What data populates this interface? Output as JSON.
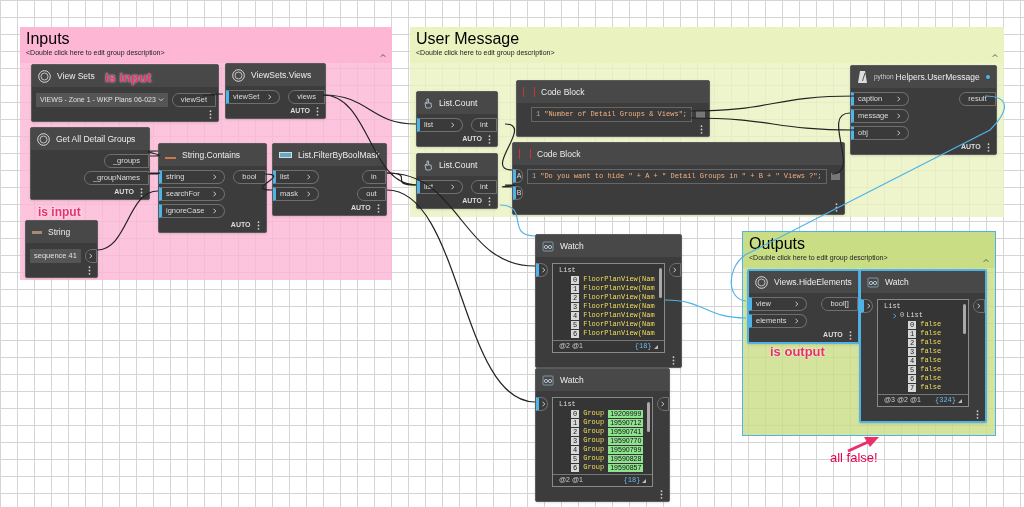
{
  "groups": [
    {
      "title": "Inputs",
      "description": "<Double click here to edit group description>",
      "color": "#fdb7d5",
      "selected": false
    },
    {
      "title": "User Message",
      "description": "<Double click here to edit group description>",
      "color": "#eaf2c0",
      "selected": false
    },
    {
      "title": "Outputs",
      "description": "<Double click here to edit group description>",
      "color": "#c9dd85",
      "selected": true
    }
  ],
  "nodes": [
    {
      "kind": "dropdown",
      "title": "View Sets",
      "value": "VIEWS - Zone 1 - WKP Plans 06-023",
      "outputs": [
        "viewSet"
      ],
      "selected": false
    },
    {
      "kind": "node",
      "title": "ViewSets.Views",
      "inputs": [
        "viewSet"
      ],
      "outputs": [
        "views"
      ],
      "footer": "AUTO",
      "selected": false
    },
    {
      "kind": "node",
      "title": "Get All Detail Groups",
      "outputs": [
        "_groups",
        "_groupNames"
      ],
      "footer": "AUTO",
      "selected": false
    },
    {
      "kind": "node",
      "title": "String.Contains",
      "inputs": [
        "string",
        "searchFor",
        "ignoreCase"
      ],
      "outputs": [
        "bool"
      ],
      "footer": "AUTO",
      "selected": false
    },
    {
      "kind": "node",
      "title": "List.FilterByBoolMask",
      "inputs": [
        "list",
        "mask"
      ],
      "outputs": [
        "in",
        "out"
      ],
      "footer": "AUTO",
      "selected": false
    },
    {
      "kind": "string_input",
      "title": "String",
      "value": "sequence 41",
      "selected": false
    },
    {
      "kind": "node",
      "title": "List.Count",
      "inputs": [
        "list"
      ],
      "outputs": [
        "int"
      ],
      "footer": "AUTO",
      "selected": false
    },
    {
      "kind": "node",
      "title": "List.Count",
      "inputs": [
        "list"
      ],
      "outputs": [
        "int"
      ],
      "footer": "AUTO",
      "selected": false
    },
    {
      "kind": "code",
      "title": "Code Block",
      "line_number": "1",
      "code": "\"Number of Detail Groups & Views\";",
      "selected": false
    },
    {
      "kind": "code",
      "title": "Code Block",
      "inputs": [
        "A",
        "B"
      ],
      "line_number": "1",
      "code": "\"Do you want to hide \" + A + \" Detail Groups in \" + B + \" Views ?\";",
      "selected": false
    },
    {
      "kind": "node",
      "title": "Helpers.UserMessage",
      "prefix": "python",
      "inputs": [
        "caption",
        "message",
        "obj"
      ],
      "outputs": [
        "result"
      ],
      "footer": "AUTO",
      "selected": false
    },
    {
      "kind": "watch",
      "title": "Watch",
      "list": {
        "header": "List",
        "items": [
          {
            "index": "0",
            "text": "FloorPlanView(Nam"
          },
          {
            "index": "1",
            "text": "FloorPlanView(Nam"
          },
          {
            "index": "2",
            "text": "FloorPlanView(Nam"
          },
          {
            "index": "3",
            "text": "FloorPlanView(Nam"
          },
          {
            "index": "4",
            "text": "FloorPlanView(Nam"
          },
          {
            "index": "5",
            "text": "FloorPlanView(Nam"
          },
          {
            "index": "6",
            "text": "FloorPlanView(Nam"
          }
        ],
        "levels": "@2 @1",
        "count": "{18}"
      },
      "selected": false
    },
    {
      "kind": "watch",
      "title": "Watch",
      "list": {
        "header": "List",
        "items": [
          {
            "index": "0",
            "text": "Group",
            "value": "19209999"
          },
          {
            "index": "1",
            "text": "Group",
            "value": "19590712"
          },
          {
            "index": "2",
            "text": "Group",
            "value": "19590741"
          },
          {
            "index": "3",
            "text": "Group",
            "value": "19590770"
          },
          {
            "index": "4",
            "text": "Group",
            "value": "19590799"
          },
          {
            "index": "5",
            "text": "Group",
            "value": "19590828"
          },
          {
            "index": "6",
            "text": "Group",
            "value": "19590857"
          }
        ],
        "levels": "@2 @1",
        "count": "{18}"
      },
      "selected": false
    },
    {
      "kind": "node",
      "title": "Views.HideElements",
      "inputs": [
        "view",
        "elements"
      ],
      "outputs": [
        "bool[]"
      ],
      "footer": "AUTO",
      "selected": true
    },
    {
      "kind": "watch",
      "title": "Watch",
      "list": {
        "header": "List",
        "sublist": {
          "index": "0",
          "label": "List"
        },
        "items": [
          {
            "index": "0",
            "text": "false"
          },
          {
            "index": "1",
            "text": "false"
          },
          {
            "index": "2",
            "text": "false"
          },
          {
            "index": "3",
            "text": "false"
          },
          {
            "index": "4",
            "text": "false"
          },
          {
            "index": "5",
            "text": "false"
          },
          {
            "index": "6",
            "text": "false"
          },
          {
            "index": "7",
            "text": "false"
          }
        ],
        "levels": "@3 @2 @1",
        "count": "{324}"
      },
      "selected": true
    }
  ],
  "annotations": [
    {
      "text": "is input"
    },
    {
      "text": "is input"
    },
    {
      "text": "is output"
    },
    {
      "text": "all false!"
    }
  ]
}
